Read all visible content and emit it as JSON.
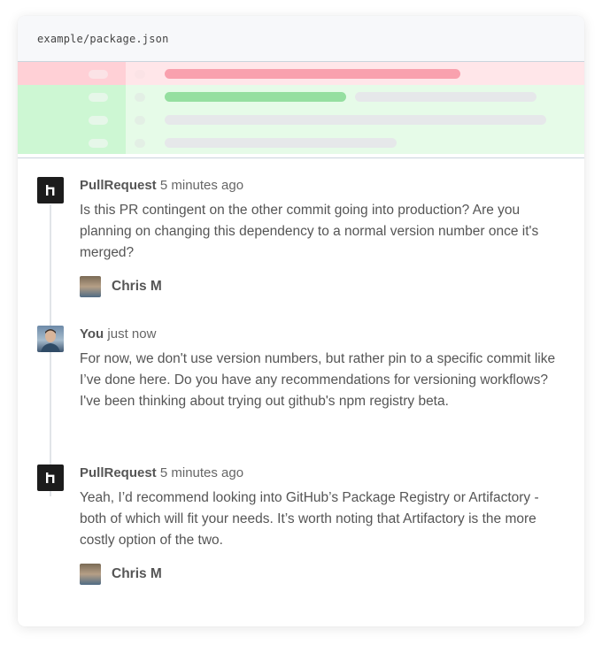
{
  "file": {
    "path": "example/package.json"
  },
  "diff": {
    "rows": [
      {
        "type": "removed"
      },
      {
        "type": "added"
      },
      {
        "type": "added"
      },
      {
        "type": "added"
      }
    ]
  },
  "colors": {
    "removed_bg": "#ffe6e9",
    "added_bg": "#e6fbe8",
    "removed_bar": "#f9a1ae",
    "added_bar": "#95dfa0",
    "placeholder_bar": "#e6e8ea"
  },
  "comments": [
    {
      "author": "PullRequest",
      "time": "5 minutes ago",
      "avatar": "pullrequest-logo-icon",
      "text": "Is this PR contingent on the other commit going into production? Are you planning on changing this dependency to a normal version number once it's merged?",
      "reviewer": "Chris M"
    },
    {
      "author": "You",
      "time": "just now",
      "avatar": "user-photo",
      "text": "For now, we don't use version numbers, but rather pin to a specific commit like I’ve done here. Do you have any recommendations for versioning workflows? I've been thinking about trying out github's npm registry beta."
    },
    {
      "author": "PullRequest",
      "time": "5 minutes ago",
      "avatar": "pullrequest-logo-icon",
      "text": "Yeah, I’d recommend looking into GitHub’s Package Registry or Artifactory - both of which will fit your needs. It’s worth noting that Artifactory is the more costly option of the two.",
      "reviewer": "Chris M"
    }
  ]
}
